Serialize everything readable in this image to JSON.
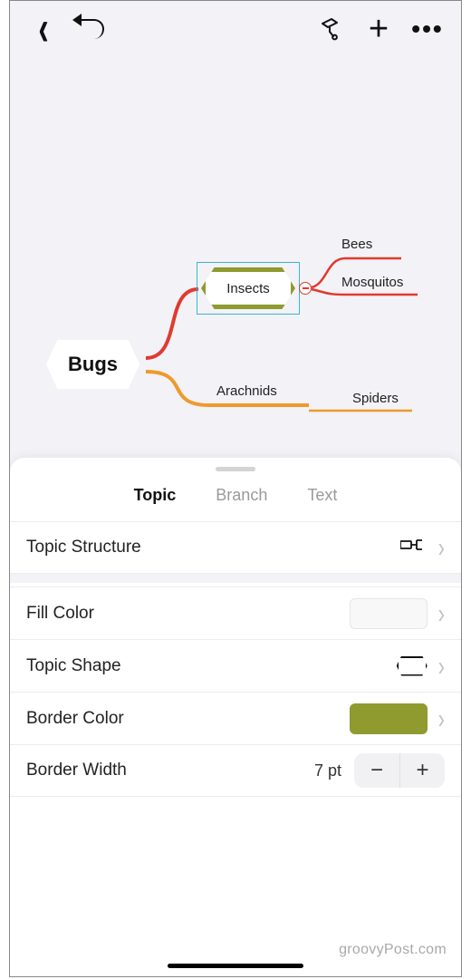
{
  "toolbar": {
    "back": "‹",
    "plus": "+",
    "more": "•••"
  },
  "mindmap": {
    "root": "Bugs",
    "selected": "Insects",
    "child1": "Bees",
    "child2": "Mosquitos",
    "branch2": "Arachnids",
    "branch2_child": "Spiders"
  },
  "tabs": {
    "topic": "Topic",
    "branch": "Branch",
    "text": "Text"
  },
  "props": {
    "structure_label": "Topic Structure",
    "fill_label": "Fill Color",
    "shape_label": "Topic Shape",
    "border_color_label": "Border Color",
    "border_color_value": "#8f9a2f",
    "border_width_label": "Border Width",
    "border_width_value": "7 pt"
  },
  "watermark": "groovyPost.com"
}
